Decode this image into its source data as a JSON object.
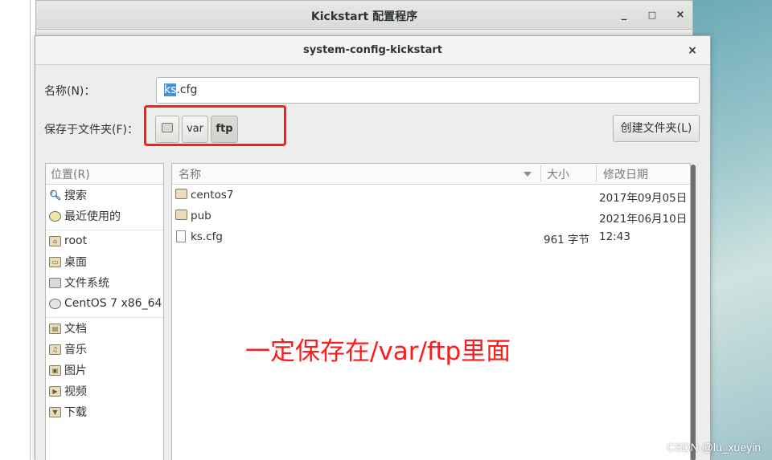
{
  "parent_window": {
    "title": "Kickstart 配置程序",
    "minimize": "_",
    "maximize": "□",
    "close": "×"
  },
  "dialog": {
    "title": "system-config-kickstart",
    "close": "×",
    "name_label": "名称(N)：",
    "name_value_selected": "ks",
    "name_value_rest": ".cfg",
    "folder_label": "保存于文件夹(F)：",
    "path_buttons": [
      "var",
      "ftp"
    ],
    "create_folder_label": "创建文件夹(L)"
  },
  "places": {
    "header": "位置(R)",
    "items": [
      {
        "label": "搜索",
        "icon": "search-icon"
      },
      {
        "label": "最近使用的",
        "icon": "recent-icon"
      },
      {
        "label": "root",
        "icon": "home-folder-icon"
      },
      {
        "label": "桌面",
        "icon": "desktop-folder-icon"
      },
      {
        "label": "文件系统",
        "icon": "filesystem-icon"
      },
      {
        "label": "CentOS 7 x86_64",
        "icon": "disc-icon"
      },
      {
        "label": "文档",
        "icon": "documents-folder-icon"
      },
      {
        "label": "音乐",
        "icon": "music-folder-icon"
      },
      {
        "label": "图片",
        "icon": "pictures-folder-icon"
      },
      {
        "label": "视频",
        "icon": "videos-folder-icon"
      },
      {
        "label": "下载",
        "icon": "downloads-folder-icon"
      }
    ]
  },
  "files": {
    "columns": {
      "name": "名称",
      "size": "大小",
      "modified": "修改日期"
    },
    "rows": [
      {
        "name": "centos7",
        "size": "",
        "modified": "2017年09月05日",
        "icon": "folder-icon"
      },
      {
        "name": "pub",
        "size": "",
        "modified": "2021年06月10日",
        "icon": "folder-icon"
      },
      {
        "name": "ks.cfg",
        "size": "961 字节",
        "modified": "12:43",
        "icon": "file-icon"
      }
    ]
  },
  "annotation": "一定保存在/var/ftp里面",
  "watermark": "CSDN @lu_xueyin",
  "colors": {
    "annotation": "#ff1b1b",
    "selection": "#4a90d9"
  }
}
